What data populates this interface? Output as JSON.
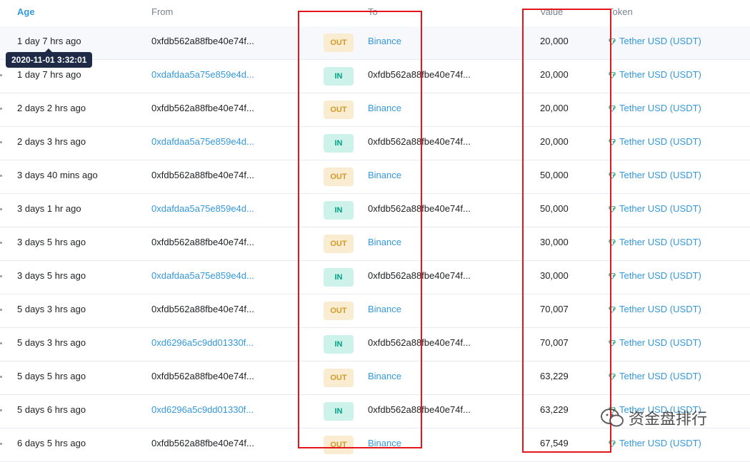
{
  "headers": {
    "age": "Age",
    "from": "From",
    "to": "To",
    "value": "Value",
    "token": "Token"
  },
  "tooltip": "2020-11-01 3:32:01",
  "watermark": "资金盘排行",
  "colors": {
    "link": "#3498db",
    "out_bg": "#f9ecd0",
    "in_bg": "#cdf2ea",
    "highlight": "#e3171b"
  },
  "rows": [
    {
      "age": "1 day 7 hrs ago",
      "from": "0xfdb562a88fbe40e74f...",
      "from_link": false,
      "dir": "OUT",
      "to": "Binance",
      "to_link": true,
      "value": "20,000",
      "token": "Tether USD (USDT)"
    },
    {
      "age": "1 day 7 hrs ago",
      "from": "0xdafdaa5a75e859e4d...",
      "from_link": true,
      "dir": "IN",
      "to": "0xfdb562a88fbe40e74f...",
      "to_link": false,
      "value": "20,000",
      "token": "Tether USD (USDT)"
    },
    {
      "age": "2 days 2 hrs ago",
      "from": "0xfdb562a88fbe40e74f...",
      "from_link": false,
      "dir": "OUT",
      "to": "Binance",
      "to_link": true,
      "value": "20,000",
      "token": "Tether USD (USDT)"
    },
    {
      "age": "2 days 3 hrs ago",
      "from": "0xdafdaa5a75e859e4d...",
      "from_link": true,
      "dir": "IN",
      "to": "0xfdb562a88fbe40e74f...",
      "to_link": false,
      "value": "20,000",
      "token": "Tether USD (USDT)"
    },
    {
      "age": "3 days 40 mins ago",
      "from": "0xfdb562a88fbe40e74f...",
      "from_link": false,
      "dir": "OUT",
      "to": "Binance",
      "to_link": true,
      "value": "50,000",
      "token": "Tether USD (USDT)"
    },
    {
      "age": "3 days 1 hr ago",
      "from": "0xdafdaa5a75e859e4d...",
      "from_link": true,
      "dir": "IN",
      "to": "0xfdb562a88fbe40e74f...",
      "to_link": false,
      "value": "50,000",
      "token": "Tether USD (USDT)"
    },
    {
      "age": "3 days 5 hrs ago",
      "from": "0xfdb562a88fbe40e74f...",
      "from_link": false,
      "dir": "OUT",
      "to": "Binance",
      "to_link": true,
      "value": "30,000",
      "token": "Tether USD (USDT)"
    },
    {
      "age": "3 days 5 hrs ago",
      "from": "0xdafdaa5a75e859e4d...",
      "from_link": true,
      "dir": "IN",
      "to": "0xfdb562a88fbe40e74f...",
      "to_link": false,
      "value": "30,000",
      "token": "Tether USD (USDT)"
    },
    {
      "age": "5 days 3 hrs ago",
      "from": "0xfdb562a88fbe40e74f...",
      "from_link": false,
      "dir": "OUT",
      "to": "Binance",
      "to_link": true,
      "value": "70,007",
      "token": "Tether USD (USDT)"
    },
    {
      "age": "5 days 3 hrs ago",
      "from": "0xd6296a5c9dd01330f...",
      "from_link": true,
      "dir": "IN",
      "to": "0xfdb562a88fbe40e74f...",
      "to_link": false,
      "value": "70,007",
      "token": "Tether USD (USDT)"
    },
    {
      "age": "5 days 5 hrs ago",
      "from": "0xfdb562a88fbe40e74f...",
      "from_link": false,
      "dir": "OUT",
      "to": "Binance",
      "to_link": true,
      "value": "63,229",
      "token": "Tether USD (USDT)"
    },
    {
      "age": "5 days 6 hrs ago",
      "from": "0xd6296a5c9dd01330f...",
      "from_link": true,
      "dir": "IN",
      "to": "0xfdb562a88fbe40e74f...",
      "to_link": false,
      "value": "63,229",
      "token": "Tether USD (USDT)"
    },
    {
      "age": "6 days 5 hrs ago",
      "from": "0xfdb562a88fbe40e74f...",
      "from_link": false,
      "dir": "OUT",
      "to": "Binance",
      "to_link": true,
      "value": "67,549",
      "token": "Tether USD (USDT)"
    }
  ]
}
